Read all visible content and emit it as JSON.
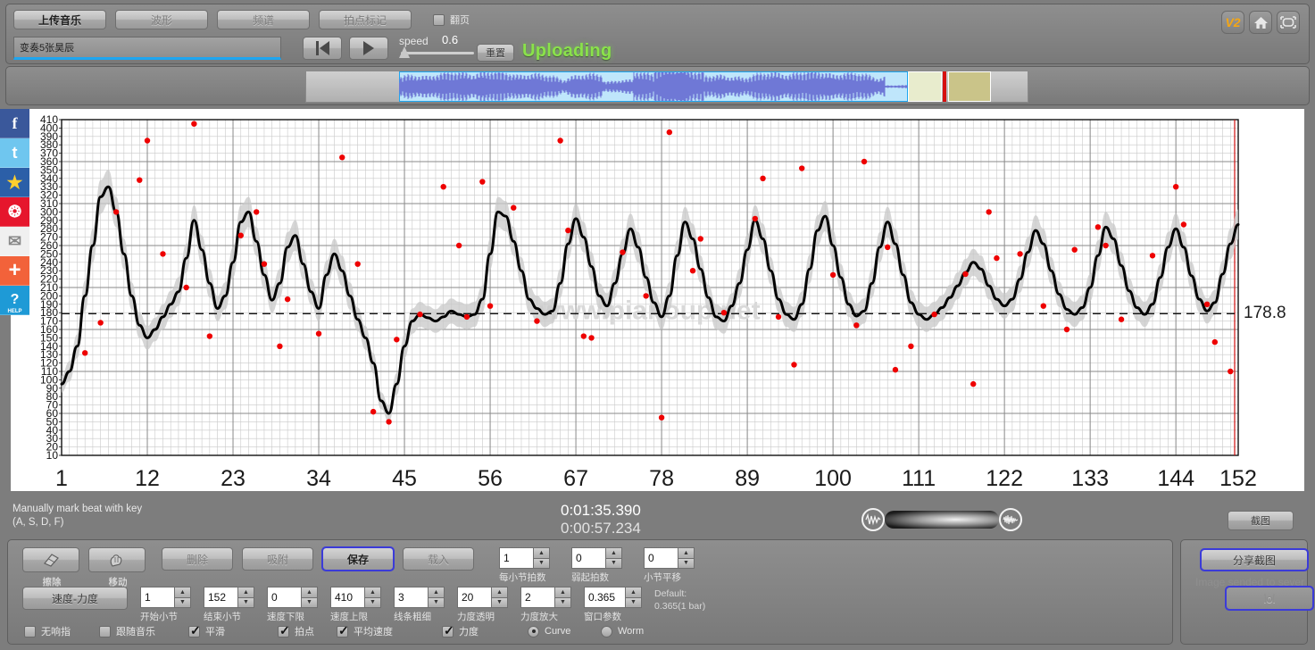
{
  "toolbar": {
    "tabs": [
      {
        "label": "上传音乐",
        "state": "active"
      },
      {
        "label": "波形",
        "state": "dim"
      },
      {
        "label": "频谱",
        "state": "dim"
      },
      {
        "label": "拍点标记",
        "state": "dim"
      }
    ],
    "page_flip_label": "翻页",
    "page_flip_checked": false,
    "song_value": "变奏5张昊辰",
    "song_placeholder": "",
    "speed_label": "speed",
    "speed_value": "0.6",
    "reset_label": "重置",
    "status_label": "Uploading",
    "status_color": "#8ae24b",
    "badge_v2": "V2",
    "home_icon": "home-icon",
    "fullscreen_icon": "fullscreen-icon"
  },
  "social": [
    {
      "name": "facebook-icon",
      "glyph": "f"
    },
    {
      "name": "twitter-icon",
      "glyph": "t"
    },
    {
      "name": "qzone-icon",
      "glyph": "★"
    },
    {
      "name": "weibo-icon",
      "glyph": "❂"
    },
    {
      "name": "email-icon",
      "glyph": "✉"
    },
    {
      "name": "share-plus-icon",
      "glyph": "+"
    },
    {
      "name": "help-icon",
      "glyph": "?",
      "sub": "HELP"
    }
  ],
  "chart_data": {
    "type": "line",
    "title": "",
    "xlabel": "",
    "ylabel": "",
    "xtick_labels": [
      "1",
      "12",
      "23",
      "34",
      "45",
      "56",
      "67",
      "78",
      "89",
      "100",
      "111",
      "122",
      "133",
      "144",
      "152"
    ],
    "xlim": [
      1,
      152
    ],
    "ylim": [
      10,
      410
    ],
    "ytick_step": 10,
    "ytick_labels": [
      "410",
      "400",
      "390",
      "380",
      "370",
      "360",
      "350",
      "340",
      "330",
      "320",
      "310",
      "300",
      "290",
      "280",
      "270",
      "260",
      "250",
      "240",
      "230",
      "220",
      "210",
      "200",
      "190",
      "180",
      "170",
      "160",
      "150",
      "140",
      "130",
      "120",
      "110",
      "100",
      "90",
      "80",
      "70",
      "60",
      "50",
      "40",
      "30",
      "20",
      "10"
    ],
    "grid": true,
    "average_line_value": 178.8,
    "average_line_label": "178.8",
    "line_color": "#000000",
    "band_color": "#c8c8c8",
    "marker_color": "#ee0000",
    "watermark": "www.pianoup.net",
    "series": [
      {
        "name": "tempo",
        "x": [
          1,
          2,
          3,
          4,
          5,
          6,
          7,
          8,
          9,
          10,
          11,
          12,
          13,
          14,
          15,
          16,
          17,
          18,
          19,
          20,
          21,
          22,
          23,
          24,
          25,
          26,
          27,
          28,
          29,
          30,
          31,
          32,
          33,
          34,
          35,
          36,
          37,
          38,
          39,
          40,
          41,
          42,
          43,
          44,
          45,
          46,
          47,
          48,
          49,
          50,
          51,
          52,
          53,
          54,
          55,
          56,
          57,
          58,
          59,
          60,
          61,
          62,
          63,
          64,
          65,
          66,
          67,
          68,
          69,
          70,
          71,
          72,
          73,
          74,
          75,
          76,
          77,
          78,
          79,
          80,
          81,
          82,
          83,
          84,
          85,
          86,
          87,
          88,
          89,
          90,
          91,
          92,
          93,
          94,
          95,
          96,
          97,
          98,
          99,
          100,
          101,
          102,
          103,
          104,
          105,
          106,
          107,
          108,
          109,
          110,
          111,
          112,
          113,
          114,
          115,
          116,
          117,
          118,
          119,
          120,
          121,
          122,
          123,
          124,
          125,
          126,
          127,
          128,
          129,
          130,
          131,
          132,
          133,
          134,
          135,
          136,
          137,
          138,
          139,
          140,
          141,
          142,
          143,
          144,
          145,
          146,
          147,
          148,
          149,
          150,
          151,
          152
        ],
        "values": [
          95,
          110,
          140,
          200,
          260,
          318,
          330,
          300,
          250,
          200,
          165,
          150,
          160,
          175,
          190,
          205,
          245,
          290,
          255,
          215,
          185,
          200,
          240,
          288,
          300,
          265,
          225,
          195,
          215,
          258,
          272,
          238,
          205,
          185,
          225,
          250,
          230,
          200,
          172,
          150,
          120,
          75,
          60,
          95,
          140,
          170,
          178,
          174,
          170,
          175,
          182,
          178,
          175,
          178,
          196,
          250,
          300,
          295,
          265,
          230,
          196,
          185,
          178,
          182,
          215,
          262,
          292,
          270,
          235,
          200,
          188,
          215,
          250,
          280,
          258,
          222,
          192,
          175,
          200,
          248,
          288,
          268,
          232,
          198,
          175,
          170,
          188,
          215,
          255,
          290,
          268,
          230,
          196,
          178,
          172,
          190,
          232,
          278,
          295,
          260,
          222,
          190,
          176,
          182,
          215,
          258,
          288,
          262,
          225,
          192,
          178,
          172,
          178,
          186,
          198,
          212,
          228,
          240,
          232,
          212,
          196,
          188,
          196,
          220,
          252,
          278,
          262,
          230,
          202,
          184,
          178,
          186,
          210,
          248,
          282,
          268,
          236,
          206,
          186,
          178,
          190,
          222,
          258,
          280,
          258,
          224,
          196,
          182,
          192,
          226,
          262,
          285
        ],
        "band_lower": [
          85,
          98,
          126,
          182,
          240,
          298,
          310,
          282,
          232,
          184,
          150,
          136,
          146,
          160,
          174,
          188,
          228,
          272,
          238,
          198,
          170,
          184,
          222,
          268,
          282,
          248,
          208,
          180,
          198,
          240,
          254,
          220,
          190,
          170,
          208,
          232,
          212,
          184,
          158,
          136,
          108,
          65,
          50,
          82,
          126,
          155,
          163,
          160,
          156,
          160,
          167,
          163,
          160,
          163,
          180,
          232,
          282,
          277,
          248,
          214,
          181,
          170,
          163,
          167,
          198,
          244,
          274,
          252,
          218,
          185,
          173,
          198,
          232,
          262,
          240,
          206,
          177,
          160,
          184,
          230,
          270,
          250,
          216,
          183,
          160,
          155,
          173,
          198,
          237,
          272,
          250,
          214,
          181,
          163,
          157,
          175,
          215,
          260,
          277,
          242,
          206,
          175,
          161,
          167,
          198,
          240,
          270,
          244,
          209,
          177,
          163,
          157,
          163,
          171,
          183,
          196,
          212,
          224,
          216,
          196,
          181,
          173,
          181,
          204,
          234,
          260,
          244,
          214,
          187,
          169,
          163,
          171,
          194,
          230,
          264,
          250,
          220,
          191,
          171,
          163,
          175,
          206,
          240,
          262,
          240,
          208,
          181,
          167,
          177,
          210,
          244,
          267
        ],
        "band_upper": [
          105,
          122,
          154,
          218,
          280,
          338,
          350,
          318,
          268,
          216,
          180,
          164,
          174,
          190,
          206,
          222,
          262,
          308,
          272,
          232,
          200,
          216,
          258,
          308,
          318,
          282,
          242,
          210,
          232,
          276,
          290,
          256,
          220,
          200,
          242,
          268,
          248,
          216,
          186,
          164,
          132,
          85,
          70,
          108,
          154,
          185,
          193,
          188,
          184,
          190,
          197,
          193,
          190,
          193,
          212,
          268,
          318,
          313,
          282,
          246,
          211,
          200,
          193,
          197,
          232,
          280,
          310,
          288,
          252,
          215,
          203,
          232,
          268,
          298,
          276,
          238,
          207,
          190,
          216,
          266,
          306,
          286,
          248,
          213,
          190,
          185,
          203,
          232,
          273,
          308,
          286,
          246,
          211,
          193,
          187,
          205,
          249,
          296,
          313,
          278,
          238,
          205,
          191,
          197,
          232,
          276,
          306,
          280,
          241,
          207,
          193,
          187,
          193,
          201,
          213,
          228,
          244,
          256,
          248,
          228,
          211,
          203,
          211,
          236,
          270,
          296,
          280,
          246,
          217,
          199,
          193,
          201,
          226,
          266,
          300,
          286,
          252,
          221,
          201,
          193,
          205,
          238,
          276,
          298,
          276,
          240,
          211,
          197,
          207,
          242,
          280,
          303
        ]
      }
    ],
    "scatter_markers": {
      "name": "beat-markers",
      "x": [
        4,
        8,
        11,
        14,
        17,
        20,
        24,
        27,
        30,
        34,
        37,
        41,
        44,
        47,
        50,
        53,
        56,
        59,
        62,
        66,
        69,
        73,
        76,
        79,
        83,
        86,
        90,
        93,
        96,
        100,
        103,
        107,
        110,
        113,
        117,
        120,
        124,
        127,
        130,
        134,
        137,
        141,
        144,
        148,
        151,
        6,
        18,
        29,
        43,
        55,
        68,
        82,
        95,
        108,
        121,
        135,
        149,
        12,
        26,
        39,
        52,
        65,
        78,
        91,
        104,
        118,
        131,
        145
      ],
      "y": [
        132,
        300,
        338,
        250,
        210,
        152,
        272,
        238,
        196,
        155,
        365,
        62,
        148,
        178,
        330,
        175,
        188,
        305,
        170,
        278,
        150,
        252,
        200,
        395,
        268,
        180,
        292,
        175,
        352,
        225,
        165,
        258,
        140,
        178,
        226,
        300,
        250,
        188,
        160,
        282,
        172,
        248,
        330,
        190,
        110,
        168,
        405,
        140,
        50,
        336,
        152,
        230,
        118,
        112,
        245,
        260,
        145,
        385,
        300,
        238,
        260,
        385,
        55,
        340,
        360,
        95,
        255,
        285
      ]
    }
  },
  "status": {
    "hint_line1": "Manually mark beat with key",
    "hint_line2": "(A, S, D, F)",
    "time_total": "0:01:35.390",
    "time_current": "0:00:57.234",
    "screenshot_label": "截图",
    "volume_left_icon": "waveform-low-icon",
    "volume_right_icon": "waveform-high-icon"
  },
  "controls": {
    "icon_buttons": [
      {
        "label": "擦除",
        "icon": "eraser-icon"
      },
      {
        "label": "移动",
        "icon": "hand-move-icon"
      }
    ],
    "word_buttons": [
      {
        "label": "删除",
        "state": "dim"
      },
      {
        "label": "吸附",
        "state": "dim"
      },
      {
        "label": "保存",
        "state": "focus"
      },
      {
        "label": "载入",
        "state": "dim"
      }
    ],
    "row1_spinners": [
      {
        "label": "每小节拍数",
        "value": "1"
      },
      {
        "label": "弱起拍数",
        "value": "0"
      },
      {
        "label": "小节平移",
        "value": "0"
      }
    ],
    "mode_button": "速度-力度",
    "row2_spinners": [
      {
        "label": "开始小节",
        "value": "1"
      },
      {
        "label": "结束小节",
        "value": "152"
      },
      {
        "label": "速度下限",
        "value": "0"
      },
      {
        "label": "速度上限",
        "value": "410"
      },
      {
        "label": "线条粗细",
        "value": "3"
      },
      {
        "label": "力度透明",
        "value": "20"
      },
      {
        "label": "力度放大",
        "value": "2"
      },
      {
        "label": "窗口参数",
        "value": "0.365"
      }
    ],
    "default_line1": "Default:",
    "default_line2": "0.365(1 bar)",
    "checkboxes": [
      {
        "label": "无响指",
        "checked": false
      },
      {
        "label": "跟随音乐",
        "checked": false
      },
      {
        "label": "平滑",
        "checked": true
      },
      {
        "label": "拍点",
        "checked": true
      },
      {
        "label": "平均速度",
        "checked": true
      },
      {
        "label": "力度",
        "checked": true
      }
    ],
    "radios": [
      {
        "label": "Curve",
        "selected": true
      },
      {
        "label": "Worm",
        "selected": false
      }
    ]
  },
  "share": {
    "share_label": "分享截图",
    "sent_message": "Image sended to sever",
    "lol_label": "lol"
  }
}
